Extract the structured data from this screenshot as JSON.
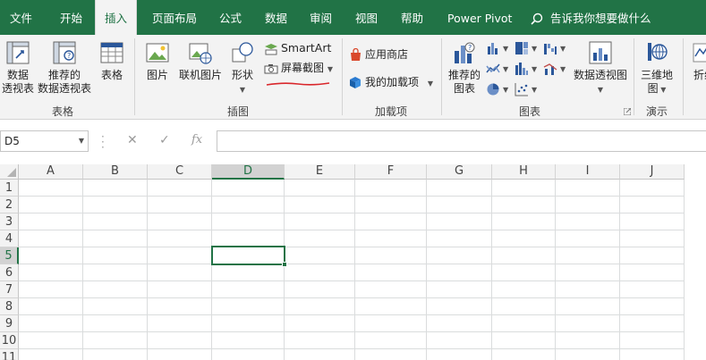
{
  "tabs": [
    {
      "label": "文件",
      "active": false
    },
    {
      "label": "开始",
      "active": false
    },
    {
      "label": "插入",
      "active": true
    },
    {
      "label": "页面布局",
      "active": false
    },
    {
      "label": "公式",
      "active": false
    },
    {
      "label": "数据",
      "active": false
    },
    {
      "label": "审阅",
      "active": false
    },
    {
      "label": "视图",
      "active": false
    },
    {
      "label": "帮助",
      "active": false
    },
    {
      "label": "Power Pivot",
      "active": false
    }
  ],
  "tell_me": "告诉我你想要做什么",
  "ribbon": {
    "groups": {
      "tables": "表格",
      "illustrations": "插图",
      "addins": "加载项",
      "charts": "图表",
      "tours": "演示"
    },
    "pivot_table": "数据\n透视表",
    "recommended_pivot": "推荐的\n数据透视表",
    "table": "表格",
    "pictures": "图片",
    "online_pictures": "联机图片",
    "shapes": "形状",
    "smartart": "SmartArt",
    "screenshot": "屏幕截图",
    "store": "应用商店",
    "my_addins": "我的加载项",
    "recommended_charts": "推荐的\n图表",
    "pivot_chart": "数据透视图",
    "map_3d": "三维地\n图",
    "line": "折线"
  },
  "formula_bar": {
    "name_box": "D5",
    "fx": "fx",
    "content": ""
  },
  "columns": [
    "A",
    "B",
    "C",
    "D",
    "E",
    "F",
    "G",
    "H",
    "I",
    "J"
  ],
  "rows": [
    "1",
    "2",
    "3",
    "4",
    "5",
    "6",
    "7",
    "8",
    "9",
    "10",
    "11"
  ],
  "selected_cell": {
    "column": "D",
    "row": "5"
  },
  "colors": {
    "accent": "#217346",
    "annotation": "#d9262b"
  }
}
